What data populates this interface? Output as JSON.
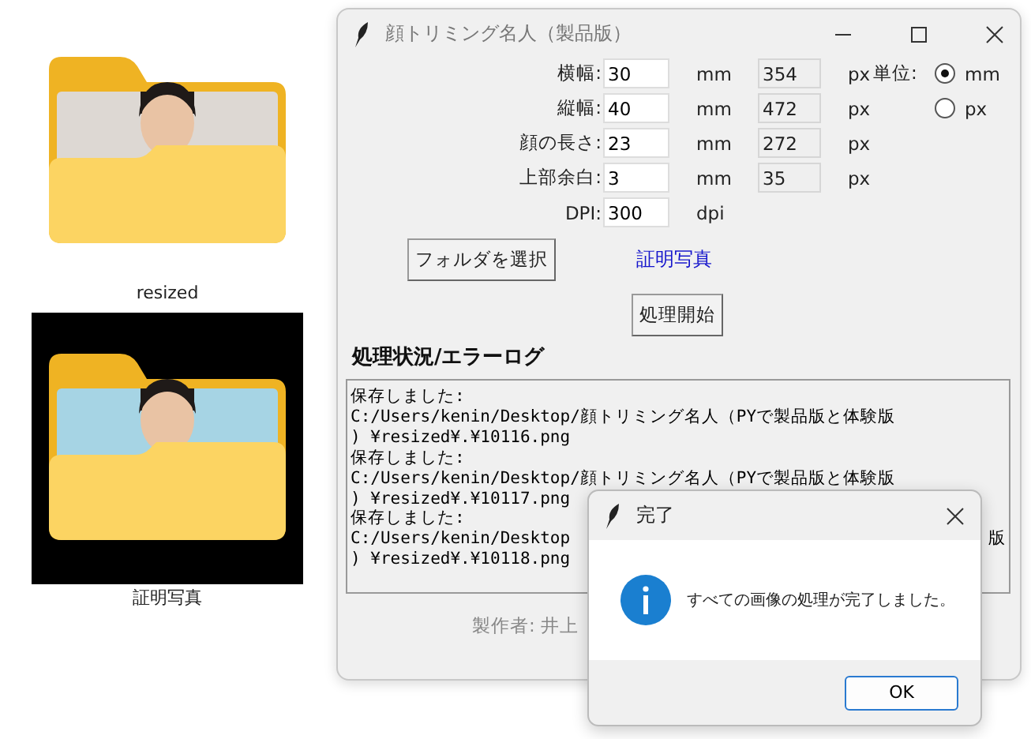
{
  "desktop": {
    "items": [
      {
        "label": "resized",
        "selected": false
      },
      {
        "label": "証明写真",
        "selected": true
      }
    ]
  },
  "window": {
    "title": "顔トリミング名人（製品版）"
  },
  "size_fields": [
    {
      "label": "横幅:",
      "value": "30",
      "unit": "mm",
      "px_value": "354",
      "px_unit": "px"
    },
    {
      "label": "縦幅:",
      "value": "40",
      "unit": "mm",
      "px_value": "472",
      "px_unit": "px"
    },
    {
      "label": "顔の長さ:",
      "value": "23",
      "unit": "mm",
      "px_value": "272",
      "px_unit": "px"
    },
    {
      "label": "上部余白:",
      "value": "3",
      "unit": "mm",
      "px_value": "35",
      "px_unit": "px"
    }
  ],
  "unit_setting": {
    "label": "単位:",
    "options": [
      {
        "label": "mm",
        "selected": true
      },
      {
        "label": "px",
        "selected": false
      }
    ]
  },
  "dpi": {
    "label": "DPI:",
    "value": "300",
    "unit": "dpi"
  },
  "folder_button": "フォルダを選択",
  "folder_name": "証明写真",
  "start_button": "処理開始",
  "log_heading": "処理状況/エラーログ",
  "log_lines": [
    {
      "text": "保存しました:"
    },
    {
      "text": "C:/Users/kenin/Desktop/顔トリミング名人（PYで製品版と体験版"
    },
    {
      "text": ") ¥resized¥.¥10116.png"
    },
    {
      "text": "保存しました:"
    },
    {
      "text": "C:/Users/kenin/Desktop/顔トリミング名人（PYで製品版と体験版"
    },
    {
      "text": ") ¥resized¥.¥10117.png"
    },
    {
      "text": "保存しました:"
    },
    {
      "text": "C:/Users/kenin/Desktop",
      "end": "版"
    },
    {
      "text": ") ¥resized¥.¥10118.png"
    }
  ],
  "footer": "製作者: 井上",
  "dialog": {
    "title": "完了",
    "message": "すべての画像の処理が完了しました。",
    "button": "OK"
  }
}
